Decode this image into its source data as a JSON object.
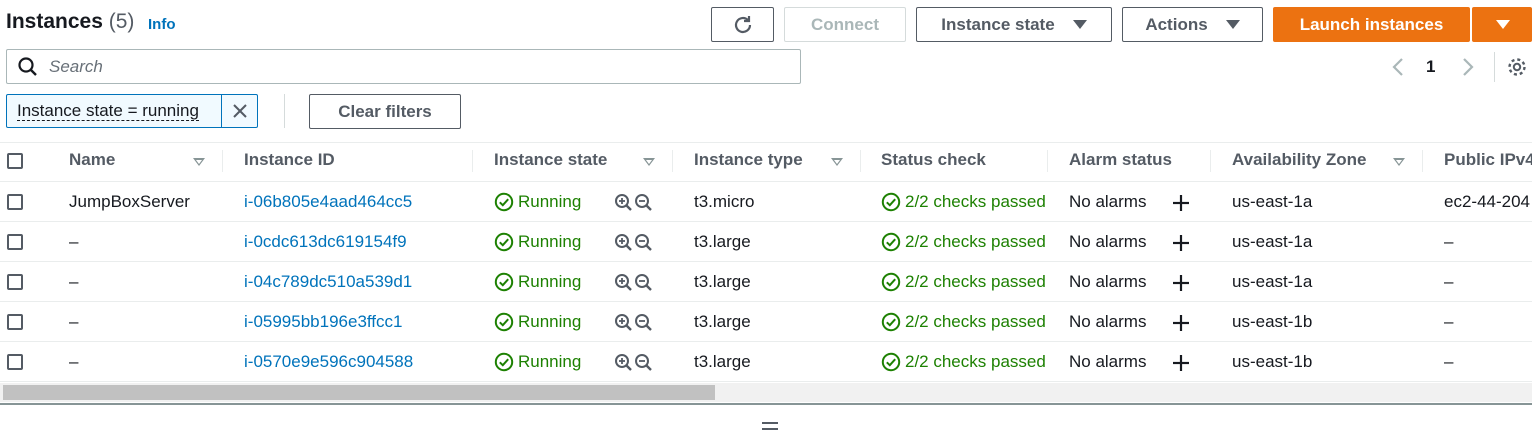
{
  "header": {
    "title": "Instances",
    "count": "(5)",
    "info": "Info"
  },
  "toolbar": {
    "connect": "Connect",
    "instance_state": "Instance state",
    "actions": "Actions",
    "launch": "Launch instances"
  },
  "search": {
    "placeholder": "Search"
  },
  "pagination": {
    "page": "1"
  },
  "filter": {
    "chip_label": "Instance state = running",
    "clear": "Clear filters"
  },
  "colors": {
    "primary": "#ec7211",
    "link": "#0073bb",
    "success": "#1d8102"
  },
  "table": {
    "columns": {
      "name": "Name",
      "instance_id": "Instance ID",
      "instance_state": "Instance state",
      "instance_type": "Instance type",
      "status_check": "Status check",
      "alarm_status": "Alarm status",
      "availability_zone": "Availability Zone",
      "public_ipv4": "Public IPv4"
    },
    "rows": [
      {
        "name": "JumpBoxServer",
        "id": "i-06b805e4aad464cc5",
        "state": "Running",
        "type": "t3.micro",
        "status": "2/2 checks passed",
        "alarm": "No alarms",
        "az": "us-east-1a",
        "ipv4": "ec2-44-204"
      },
      {
        "name": "–",
        "id": "i-0cdc613dc619154f9",
        "state": "Running",
        "type": "t3.large",
        "status": "2/2 checks passed",
        "alarm": "No alarms",
        "az": "us-east-1a",
        "ipv4": "–"
      },
      {
        "name": "–",
        "id": "i-04c789dc510a539d1",
        "state": "Running",
        "type": "t3.large",
        "status": "2/2 checks passed",
        "alarm": "No alarms",
        "az": "us-east-1a",
        "ipv4": "–"
      },
      {
        "name": "–",
        "id": "i-05995bb196e3ffcc1",
        "state": "Running",
        "type": "t3.large",
        "status": "2/2 checks passed",
        "alarm": "No alarms",
        "az": "us-east-1b",
        "ipv4": "–"
      },
      {
        "name": "–",
        "id": "i-0570e9e596c904588",
        "state": "Running",
        "type": "t3.large",
        "status": "2/2 checks passed",
        "alarm": "No alarms",
        "az": "us-east-1b",
        "ipv4": "–"
      }
    ]
  }
}
